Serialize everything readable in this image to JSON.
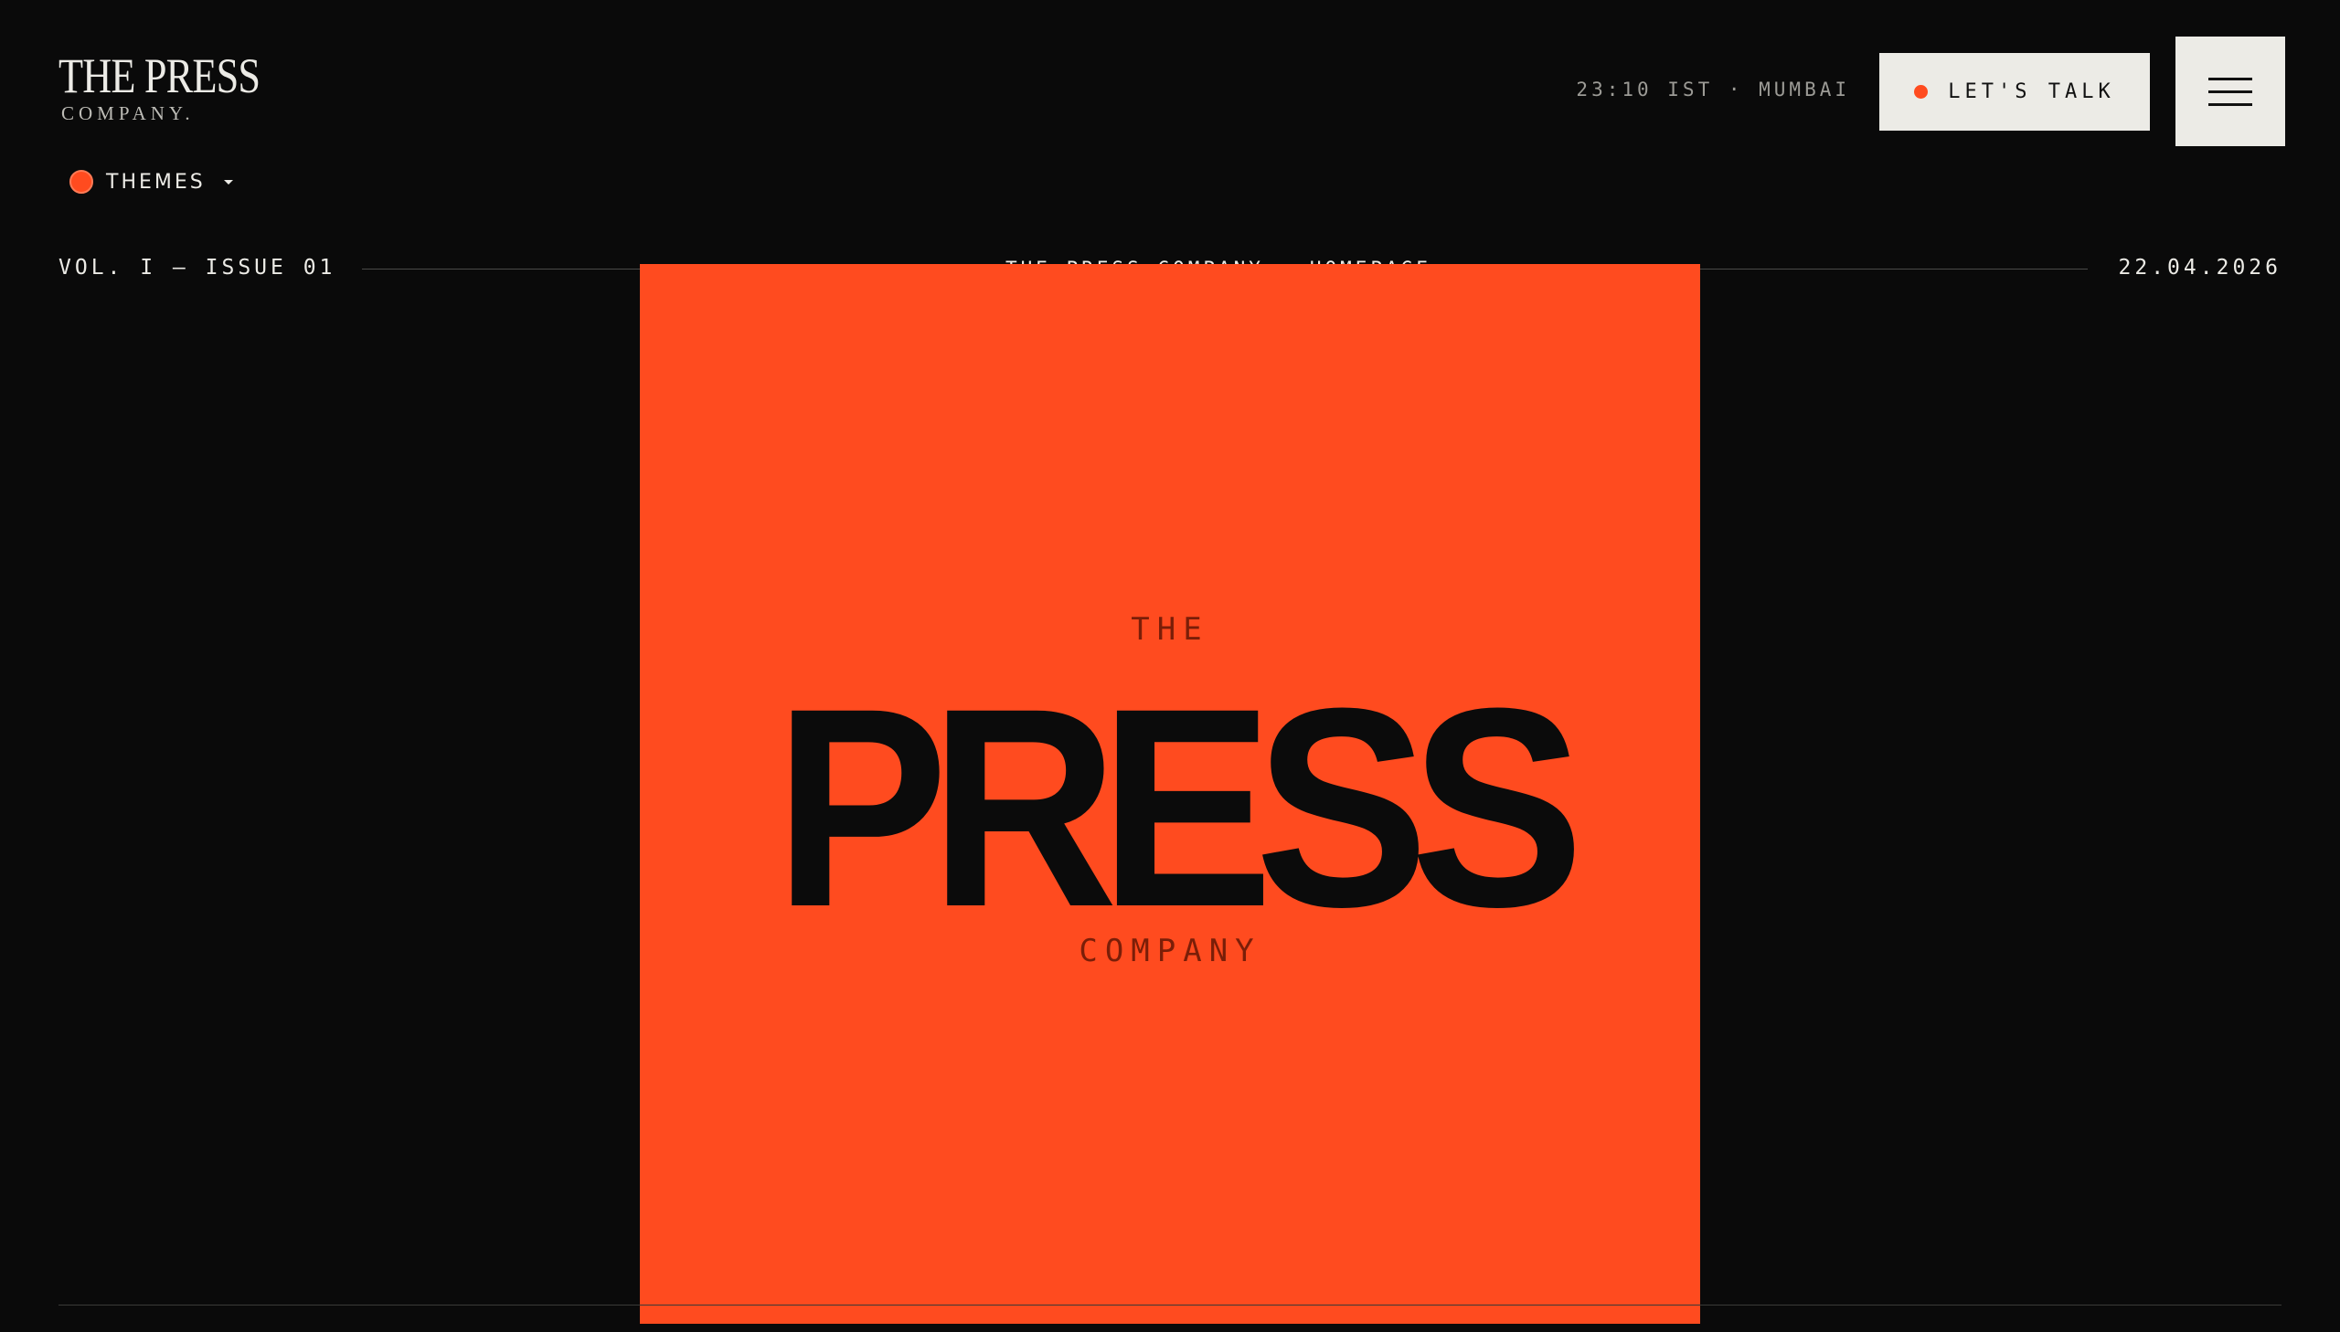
{
  "brand": {
    "logo_main": "THE PRESS",
    "logo_sub": "COMPANY."
  },
  "header": {
    "clock": "23:10 IST · MUMBAI",
    "talk_label": "LET'S TALK",
    "themes_label": "THEMES"
  },
  "masthead": {
    "issue": "VOL. I — ISSUE 01",
    "breadcrumb": "THE PRESS COMPANY · HOMEPAGE",
    "date": "22.04.2026"
  },
  "hero": {
    "the": "THE",
    "press": "PRESS",
    "company": "COMPANY"
  },
  "colors": {
    "background": "#0a0a0a",
    "accent": "#ff4b1f",
    "paper": "#ecebe6",
    "ink": "#0b0b0b"
  },
  "icons": {
    "menu": "hamburger-menu-icon",
    "themes_caret": "chevron-down-icon"
  }
}
